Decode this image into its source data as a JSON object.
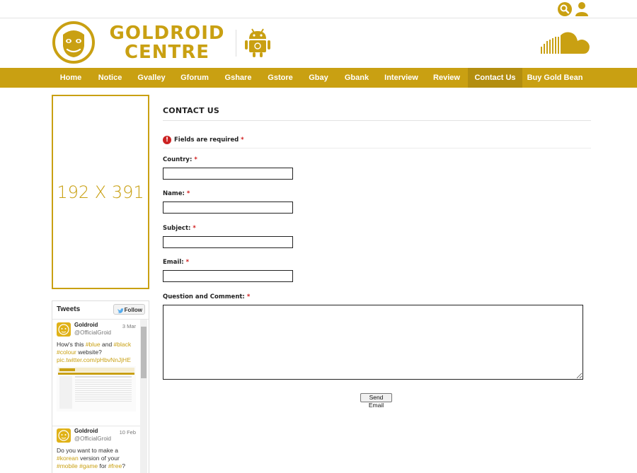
{
  "topbar": {
    "search_icon": "search-icon",
    "user_icon": "user-icon"
  },
  "logo": {
    "line1": "GOLDROID",
    "line2": "CENTRE",
    "mask_icon": "mask-logo-icon",
    "android_icon": "android-robot-icon"
  },
  "social": {
    "soundcloud_icon": "soundcloud-icon"
  },
  "colors": {
    "gold": "#c9a012",
    "gold_dark": "#b38e10",
    "required_red": "#d01a1a"
  },
  "nav": {
    "items": [
      {
        "label": "Home"
      },
      {
        "label": "Notice"
      },
      {
        "label": "Gvalley"
      },
      {
        "label": "Gforum"
      },
      {
        "label": "Gshare"
      },
      {
        "label": "Gstore"
      },
      {
        "label": "Gbay"
      },
      {
        "label": "Gbank"
      },
      {
        "label": "Interview"
      },
      {
        "label": "Review"
      },
      {
        "label": "Contact Us",
        "active": true
      },
      {
        "label": "Buy Gold Bean"
      }
    ]
  },
  "ad": {
    "label": "192 X 391"
  },
  "tweets": {
    "title": "Tweets",
    "follow": "Follow",
    "items": [
      {
        "name": "Goldroid",
        "handle": "@OfficialGroid",
        "date": "3 Mar",
        "text_a": "How's this ",
        "tag1": "#blue",
        "text_b": " and ",
        "tag2": "#black",
        "tag3": "#colour",
        "text_c": " website?",
        "link": "pic.twitter.com/pHbvNnJjHE"
      },
      {
        "name": "Goldroid",
        "handle": "@OfficialGroid",
        "date": "10 Feb",
        "text_a": "Do you want to make a",
        "tag1": "#korean",
        "text_b": " version of your",
        "tag2": "#mobile",
        "tag3": "#game",
        "text_c": " for ",
        "tag4": "#free",
        "text_d": "?"
      }
    ]
  },
  "form": {
    "title": "CONTACT US",
    "required_note": "Fields are required",
    "star": "*",
    "fields": [
      {
        "label": "Country:",
        "value": ""
      },
      {
        "label": "Name:",
        "value": ""
      },
      {
        "label": "Subject:",
        "value": ""
      },
      {
        "label": "Email:",
        "value": ""
      }
    ],
    "comment_label": "Question and Comment:",
    "comment_value": "",
    "submit": "Send Email"
  }
}
